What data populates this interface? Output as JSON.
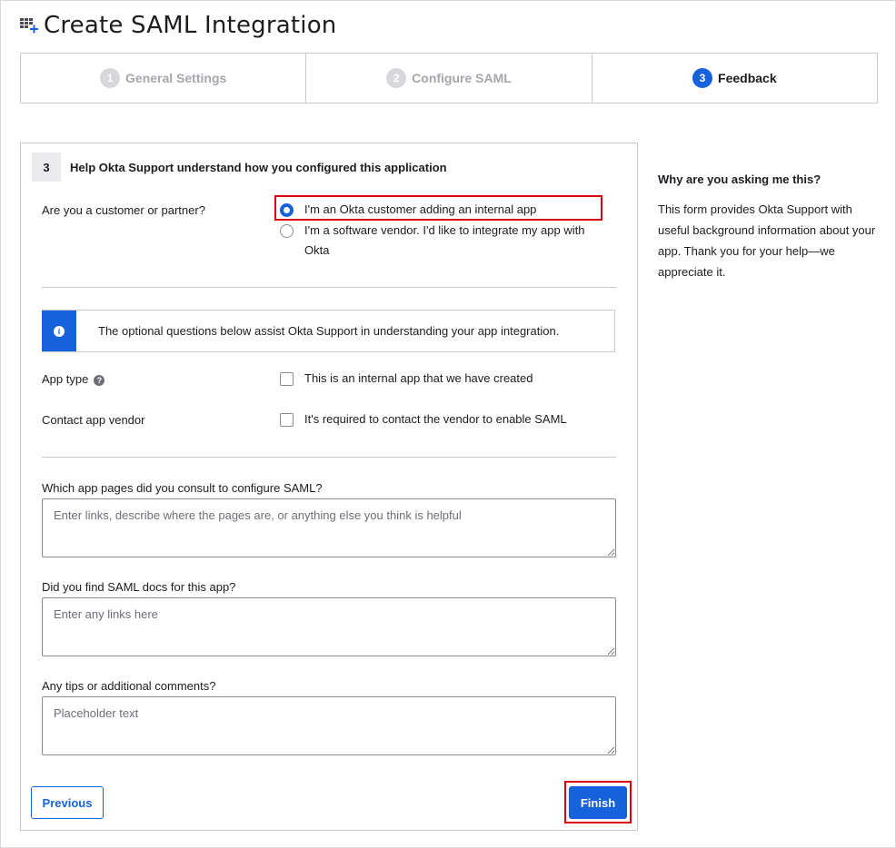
{
  "header": {
    "title": "Create SAML Integration",
    "icon": "app-grid-add-icon"
  },
  "stepper": [
    {
      "num": "1",
      "label": "General Settings",
      "active": false
    },
    {
      "num": "2",
      "label": "Configure SAML",
      "active": false
    },
    {
      "num": "3",
      "label": "Feedback",
      "active": true
    }
  ],
  "form": {
    "section_num": "3",
    "section_title": "Help Okta Support understand how you configured this application",
    "customer_label": "Are you a customer or partner?",
    "customer_options": [
      {
        "label": "I'm an Okta customer adding an internal app",
        "checked": true
      },
      {
        "label": "I'm a software vendor. I'd like to integrate my app with",
        "label2": "Okta",
        "checked": false
      }
    ],
    "info": "The optional questions below assist Okta Support in understanding your app integration.",
    "app_type_label": "App type",
    "app_type_option": "This is an internal app that we have created",
    "contact_label": "Contact app vendor",
    "contact_option": "It's required to contact the vendor to enable SAML",
    "pages_label": "Which app pages did you consult to configure SAML?",
    "pages_placeholder": "Enter links, describe where the pages are, or anything else you think is helpful",
    "docs_label": "Did you find SAML docs for this app?",
    "docs_placeholder": "Enter any links here",
    "tips_label": "Any tips or additional comments?",
    "tips_placeholder": "Placeholder text",
    "previous": "Previous",
    "finish": "Finish"
  },
  "side": {
    "title": "Why are you asking me this?",
    "text": "This form provides Okta Support with useful background information about your app. Thank you for your help—we appreciate it."
  },
  "colors": {
    "accent": "#1662dd",
    "highlight": "#d9000d"
  }
}
